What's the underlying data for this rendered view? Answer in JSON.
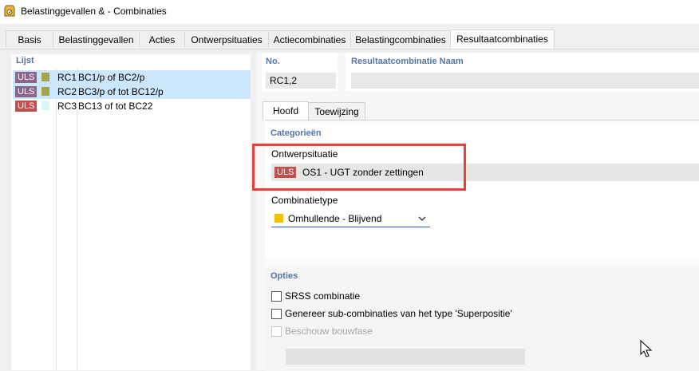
{
  "window": {
    "title": "Belastinggevallen & - Combinaties",
    "app_icon": "app-icon"
  },
  "tabs": [
    {
      "label": "Basis"
    },
    {
      "label": "Belastinggevallen"
    },
    {
      "label": "Acties"
    },
    {
      "label": "Ontwerpsituaties"
    },
    {
      "label": "Actiecombinaties"
    },
    {
      "label": "Belastingcombinaties"
    },
    {
      "label": "Resultaatcombinaties",
      "active": true
    }
  ],
  "list": {
    "header": "Lijst",
    "items": [
      {
        "badge": "ULS",
        "color": "#a3a64c",
        "id": "RC1",
        "name": "BC1/p of BC2/p",
        "selected": true,
        "badge_color": "#8c658c"
      },
      {
        "badge": "ULS",
        "color": "#a3a64c",
        "id": "RC2",
        "name": "BC3/p of tot BC12/p",
        "selected": true,
        "badge_color": "#8c658c"
      },
      {
        "badge": "ULS",
        "color": "#d9f7fb",
        "id": "RC3",
        "name": "BC13 of tot BC22",
        "selected": false,
        "badge_color": "#c0504d"
      }
    ]
  },
  "detail": {
    "no_label": "No.",
    "no_value": "RC1,2",
    "name_label": "Resultaatcombinatie Naam",
    "name_value": "",
    "inner_tabs": [
      {
        "label": "Hoofd",
        "active": true
      },
      {
        "label": "Toewijzing"
      }
    ],
    "categories_label": "Categorieën",
    "ontwerpsituatie_label": "Ontwerpsituatie",
    "ontwerpsituatie_badge": "ULS",
    "ontwerpsituatie_value": "OS1 - UGT zonder zettingen",
    "combinatietype_label": "Combinatietype",
    "combinatietype_value": "Omhullende - Blijvend",
    "combinatietype_color": "#f2c200",
    "opties_label": "Opties",
    "options": [
      {
        "label": "SRSS combinatie",
        "checked": false,
        "enabled": true
      },
      {
        "label": "Genereer sub-combinaties van het type 'Superpositie'",
        "checked": false,
        "enabled": true
      },
      {
        "label": "Beschouw bouwfase",
        "checked": false,
        "enabled": false
      }
    ],
    "bouwfase_value": ""
  },
  "colors": {
    "accent_blue": "#5275a5",
    "highlight_red": "#e8413d",
    "selection": "#cce6fb"
  }
}
